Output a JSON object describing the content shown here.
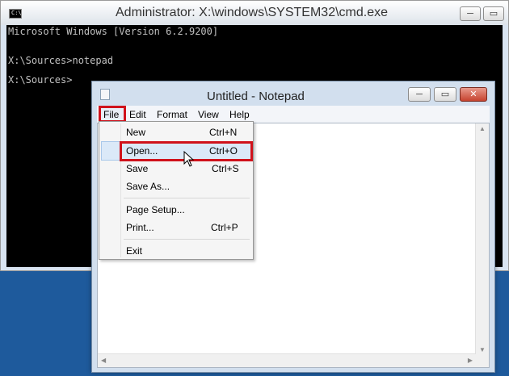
{
  "cmd": {
    "title": "Administrator: X:\\windows\\SYSTEM32\\cmd.exe",
    "icon_text": "C:\\",
    "lines": [
      "Microsoft Windows [Version 6.2.9200]",
      "X:\\Sources>notepad",
      "X:\\Sources>"
    ],
    "buttons": {
      "minimize": "─",
      "maximize": "▭"
    }
  },
  "notepad": {
    "title": "Untitled - Notepad",
    "buttons": {
      "minimize": "─",
      "maximize": "▭",
      "close": "✕"
    },
    "menu": [
      "File",
      "Edit",
      "Format",
      "View",
      "Help"
    ]
  },
  "file_menu": {
    "items": [
      {
        "label": "New",
        "shortcut": "Ctrl+N"
      },
      {
        "label": "Open...",
        "shortcut": "Ctrl+O"
      },
      {
        "label": "Save",
        "shortcut": "Ctrl+S"
      },
      {
        "label": "Save As...",
        "shortcut": ""
      },
      {
        "label": "Page Setup...",
        "shortcut": ""
      },
      {
        "label": "Print...",
        "shortcut": "Ctrl+P"
      },
      {
        "label": "Exit",
        "shortcut": ""
      }
    ]
  },
  "colors": {
    "highlight_red": "#d0121b",
    "console_bg": "#000000",
    "console_text": "#c0c0c0",
    "desktop_blue": "#1e5a9c"
  }
}
